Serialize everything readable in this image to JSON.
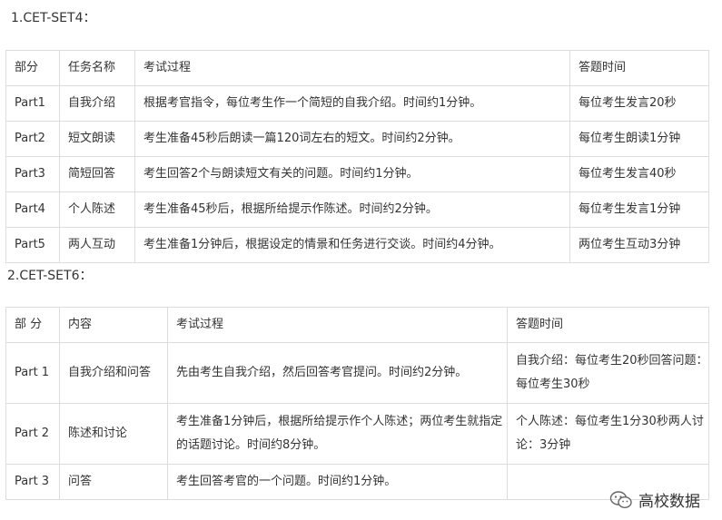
{
  "section1": {
    "title": "1.CET-SET4：",
    "headers": [
      "部分",
      "任务名称",
      "考试过程",
      "答题时间"
    ],
    "rows": [
      [
        "Part1",
        "自我介绍",
        "根据考官指令，每位考生作一个简短的自我介绍。时间约1分钟。",
        "每位考生发言20秒"
      ],
      [
        "Part2",
        "短文朗读",
        "考生准备45秒后朗读一篇120词左右的短文。时间约2分钟。",
        "每位考生朗读1分钟"
      ],
      [
        "Part3",
        "简短回答",
        "考生回答2个与朗读短文有关的问题。时间约1分钟。",
        "每位考生发言40秒"
      ],
      [
        "Part4",
        "个人陈述",
        "考生准备45秒后，根据所给提示作陈述。时间约2分钟。",
        "每位考生发言1分钟"
      ],
      [
        "Part5",
        "两人互动",
        "考生准备1分钟后，根据设定的情景和任务进行交谈。时间约4分钟。",
        "两位考生互动3分钟"
      ]
    ]
  },
  "section2": {
    "title": "2.CET-SET6：",
    "headers": [
      "部 分",
      "内容",
      "考试过程",
      "答题时间"
    ],
    "rows": [
      [
        "Part 1",
        "自我介绍和问答",
        "先由考生自我介绍，然后回答考官提问。时间约2分钟。",
        "自我介绍：每位考生20秒回答问题：每位考生30秒"
      ],
      [
        "Part 2",
        "陈述和讨论",
        "考生准备1分钟后，根据所给提示作个人陈述；两位考生就指定的话题讨论。时间约8分钟。",
        "个人陈述：每位考生1分30秒两人讨论：3分钟"
      ],
      [
        "Part 3",
        "问答",
        "考生回答考官的一个问题。时间约1分钟。",
        ""
      ]
    ]
  },
  "watermark": {
    "text": "高校数据",
    "icon": "wechat-icon"
  }
}
